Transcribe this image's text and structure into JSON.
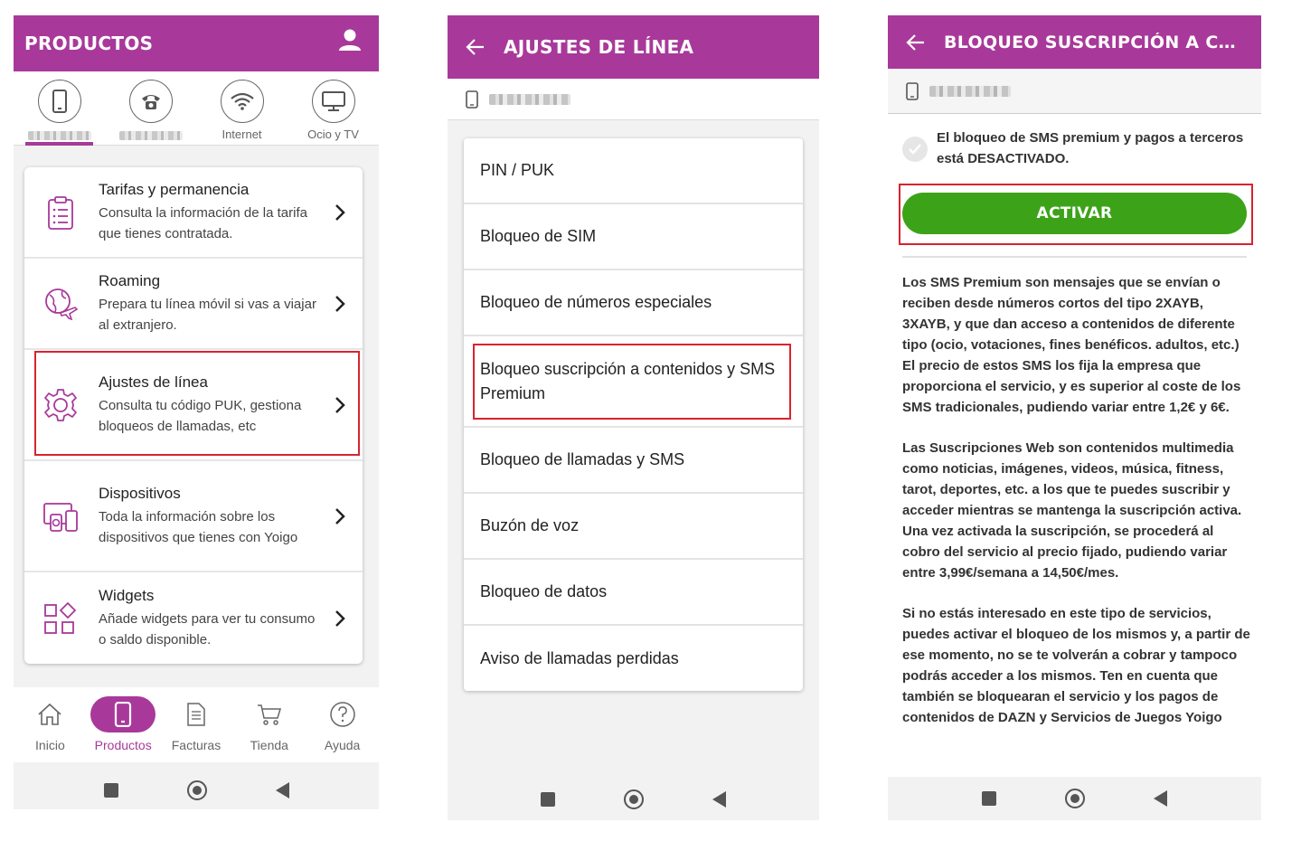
{
  "screen1": {
    "title": "PRODUCTOS",
    "tabs": [
      {
        "label": "",
        "icon": "mobile-icon"
      },
      {
        "label": "",
        "icon": "phone-icon"
      },
      {
        "label": "Internet",
        "icon": "wifi-icon"
      },
      {
        "label": "Ocio y TV",
        "icon": "monitor-icon"
      }
    ],
    "items": [
      {
        "title": "Tarifas y permanencia",
        "desc": "Consulta la información de la tarifa que tienes contratada.",
        "icon": "clipboard-icon"
      },
      {
        "title": "Roaming",
        "desc": "Prepara tu línea móvil si vas a viajar al extranjero.",
        "icon": "globe-plane-icon"
      },
      {
        "title": "Ajustes de línea",
        "desc": "Consulta tu código PUK, gestiona bloqueos de llamadas, etc",
        "icon": "gear-icon"
      },
      {
        "title": "Dispositivos",
        "desc": "Toda la información sobre los dispositivos que tienes con Yoigo",
        "icon": "devices-icon"
      },
      {
        "title": "Widgets",
        "desc": "Añade widgets para ver tu consumo o saldo disponible.",
        "icon": "widgets-icon"
      }
    ],
    "nav": [
      {
        "label": "Inicio",
        "icon": "home-icon"
      },
      {
        "label": "Productos",
        "icon": "mobile-icon"
      },
      {
        "label": "Facturas",
        "icon": "invoice-icon"
      },
      {
        "label": "Tienda",
        "icon": "cart-icon"
      },
      {
        "label": "Ayuda",
        "icon": "help-icon"
      }
    ]
  },
  "screen2": {
    "title": "AJUSTES DE LÍNEA",
    "items": [
      "PIN / PUK",
      "Bloqueo de SIM",
      "Bloqueo de números especiales",
      "Bloqueo suscripción a contenidos y SMS Premium",
      "Bloqueo de llamadas y SMS",
      "Buzón de voz",
      "Bloqueo de datos",
      "Aviso de llamadas perdidas"
    ]
  },
  "screen3": {
    "title": "BLOQUEO SUSCRIPCIÓN A CONTE...",
    "status": "El bloqueo de SMS premium y pagos a terceros está DESACTIVADO.",
    "button": "ACTIVAR",
    "paragraphs": [
      "Los SMS Premium son mensajes que se envían o reciben desde números cortos del tipo 2XAYB, 3XAYB, y que dan acceso a contenidos de diferente tipo (ocio, votaciones, fines benéficos. adultos, etc.) El precio de estos SMS los fija la empresa que proporciona el servicio, y es superior al coste de los SMS tradicionales, pudiendo variar entre 1,2€ y 6€.",
      "Las Suscripciones Web son contenidos multimedia como noticias, imágenes, videos, música, fitness, tarot, deportes, etc. a los que te puedes suscribir y acceder mientras se mantenga la suscripción activa. Una vez activada la suscripción, se procederá al cobro del servicio al precio fijado, pudiendo variar entre 3,99€/semana a 14,50€/mes.",
      "Si no estás interesado en este tipo de servicios, puedes activar el bloqueo de los mismos y, a partir de ese momento, no se te volverán a cobrar y tampoco podrás acceder a los mismos. Ten en cuenta que también se bloquearan el servicio y los pagos de contenidos de DAZN y Servicios de Juegos Yoigo"
    ]
  },
  "colors": {
    "brand": "#a8399a",
    "button_green": "#3ca319",
    "highlight_red": "#d9232d"
  }
}
